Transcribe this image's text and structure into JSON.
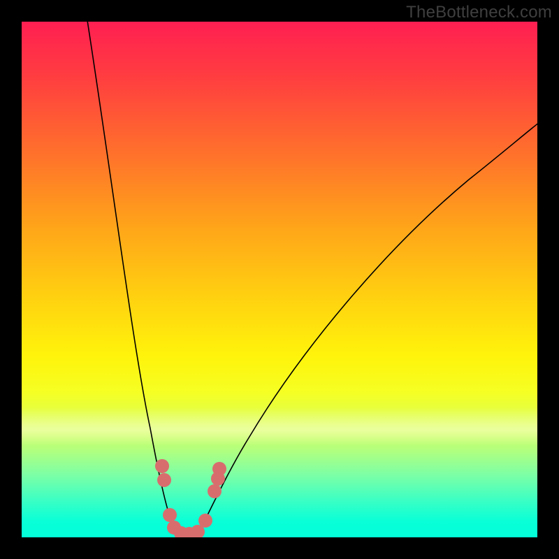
{
  "watermark": "TheBottleneck.com",
  "chart_data": {
    "type": "line",
    "title": "",
    "xlabel": "",
    "ylabel": "",
    "xlim": [
      0,
      100
    ],
    "ylim": [
      0,
      100
    ],
    "series": [
      {
        "name": "bottleneck-curve",
        "x": [
          12,
          17,
          22,
          25,
          27,
          29,
          30,
          32,
          34,
          36,
          40,
          48,
          60,
          75,
          90,
          100
        ],
        "y": [
          100,
          70,
          40,
          22,
          10,
          3,
          1,
          1,
          3,
          8,
          18,
          35,
          55,
          72,
          82,
          88
        ]
      }
    ],
    "overlay_points": {
      "name": "highlight-dots",
      "color": "#d86d6e",
      "x": [
        27.2,
        27.6,
        28.7,
        29.5,
        30.9,
        32.5,
        34.1,
        35.6,
        37.4,
        38.1,
        38.4
      ],
      "y": [
        13.8,
        11.1,
        4.3,
        1.9,
        0.8,
        0.7,
        1.1,
        3.3,
        8.9,
        11.4,
        13.3
      ]
    },
    "background": {
      "gradient_axis": "y",
      "stops": [
        {
          "y": 100,
          "color": "#ff1f52"
        },
        {
          "y": 55,
          "color": "#ffd60f"
        },
        {
          "y": 20,
          "color": "#f5ff24"
        },
        {
          "y": 0,
          "color": "#03ffd8"
        }
      ]
    }
  }
}
